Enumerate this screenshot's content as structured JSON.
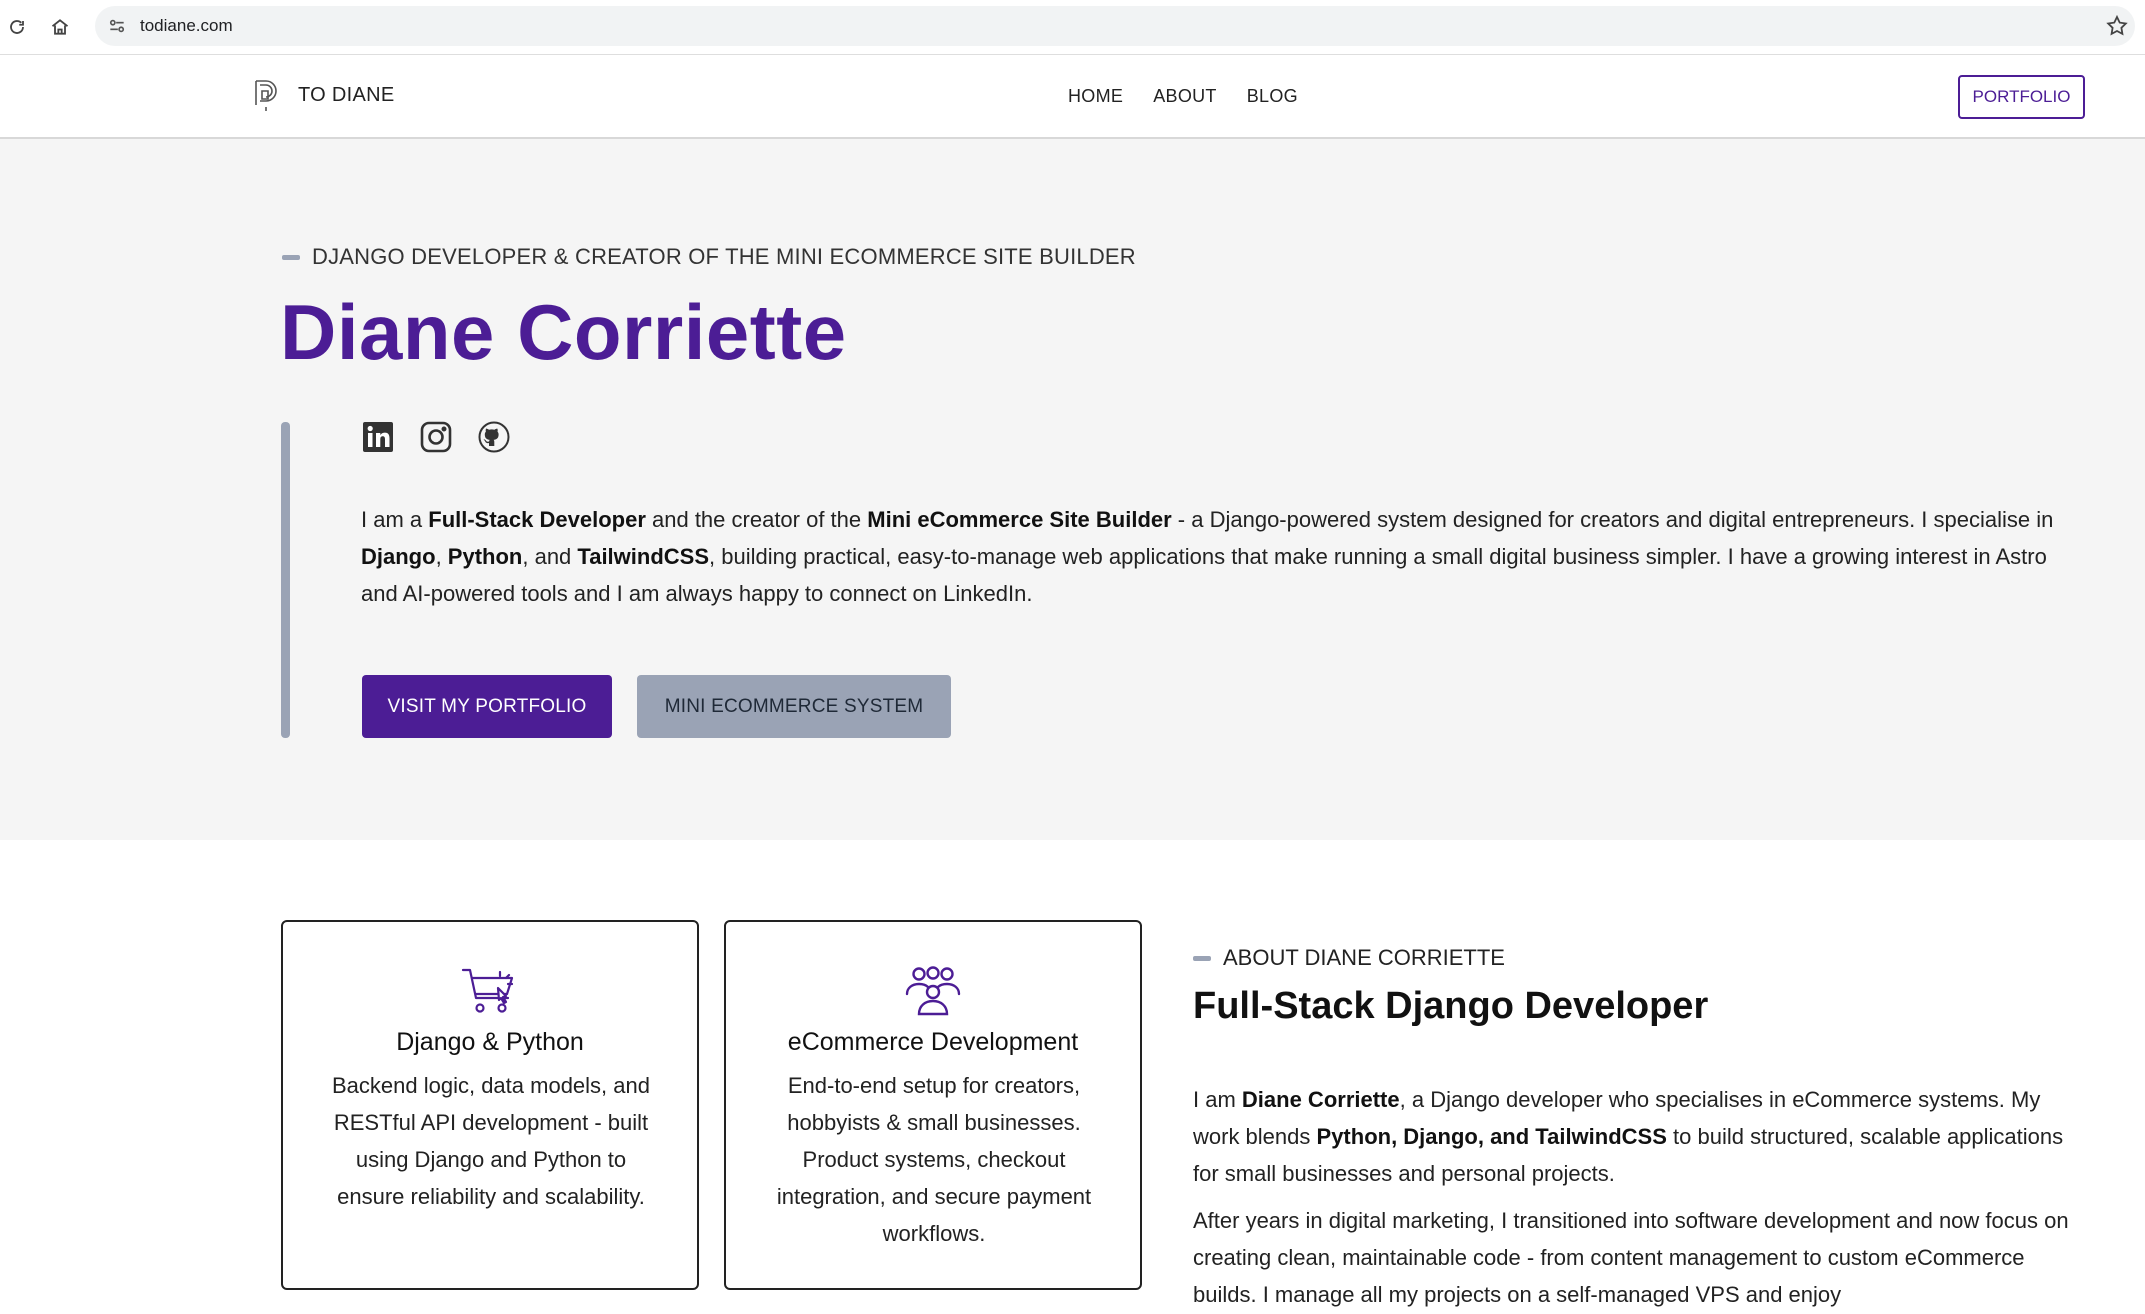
{
  "browser": {
    "url": "todiane.com"
  },
  "header": {
    "logo_text": "TO DIANE",
    "nav": [
      "HOME",
      "ABOUT",
      "BLOG"
    ],
    "portfolio_label": "PORTFOLIO"
  },
  "hero": {
    "eyebrow": "DJANGO DEVELOPER & CREATOR OF THE MINI ECOMMERCE SITE BUILDER",
    "name": "Diane Corriette",
    "socials": [
      "linkedin-icon",
      "instagram-icon",
      "github-icon"
    ],
    "intro": {
      "t1": "I am a ",
      "b1": "Full-Stack Developer",
      "t2": " and the creator of the ",
      "b2": "Mini eCommerce Site Builder",
      "t3": " - a Django-powered system designed for creators and digital entrepreneurs. I specialise in ",
      "b3": "Django",
      "t4": ", ",
      "b4": "Python",
      "t5": ", and ",
      "b5": "TailwindCSS",
      "t6": ", building practical, easy-to-manage web applications that make running a small digital business simpler. I have a growing interest in Astro and AI-powered tools and I am always happy to connect on LinkedIn."
    },
    "primary_button": "VISIT MY PORTFOLIO",
    "secondary_button": "MINI ECOMMERCE SYSTEM"
  },
  "services": [
    {
      "icon": "shopping-cart-icon",
      "title": "Django & Python",
      "text": "Backend logic, data models, and RESTful API development - built using Django and Python to ensure reliability and scalability."
    },
    {
      "icon": "users-group-icon",
      "title": "eCommerce Development",
      "text": "End-to-end setup for creators, hobbyists & small businesses. Product systems, checkout integration, and secure payment workflows."
    }
  ],
  "about": {
    "eyebrow": "ABOUT DIANE CORRIETTE",
    "title": "Full-Stack Django Developer",
    "p1": {
      "t1": "I am ",
      "b1": "Diane Corriette",
      "t2": ", a Django developer who specialises in eCommerce systems. My work blends ",
      "b2": "Python, Django, and TailwindCSS",
      "t3": " to build structured, scalable applications for small businesses and personal projects."
    },
    "p2": "After years in digital marketing, I transitioned into software development and now focus on creating clean, maintainable code - from content management to custom eCommerce builds. I manage all my projects on a self-managed VPS and enjoy"
  },
  "colors": {
    "brand": "#4c1d95",
    "hero_bg": "#f5f5f5",
    "accent_gray": "#9aa3b5"
  }
}
